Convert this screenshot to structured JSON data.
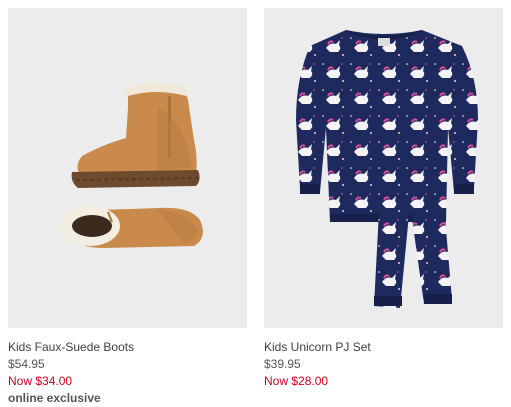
{
  "products": [
    {
      "name": "Kids Faux-Suede Boots",
      "original_price": "$54.95",
      "sale_price": "Now $34.00",
      "flag": "online exclusive",
      "image_icon": "boots-product-image"
    },
    {
      "name": "Kids Unicorn PJ Set",
      "original_price": "$39.95",
      "sale_price": "Now $28.00",
      "image_icon": "unicorn-pajamas-product-image"
    }
  ],
  "colors": {
    "sale": "#d0021b",
    "text": "#3f3f3f",
    "image_bg": "#ececec",
    "boot_tan": "#c98a4b",
    "pj_navy": "#1e2a5e"
  }
}
